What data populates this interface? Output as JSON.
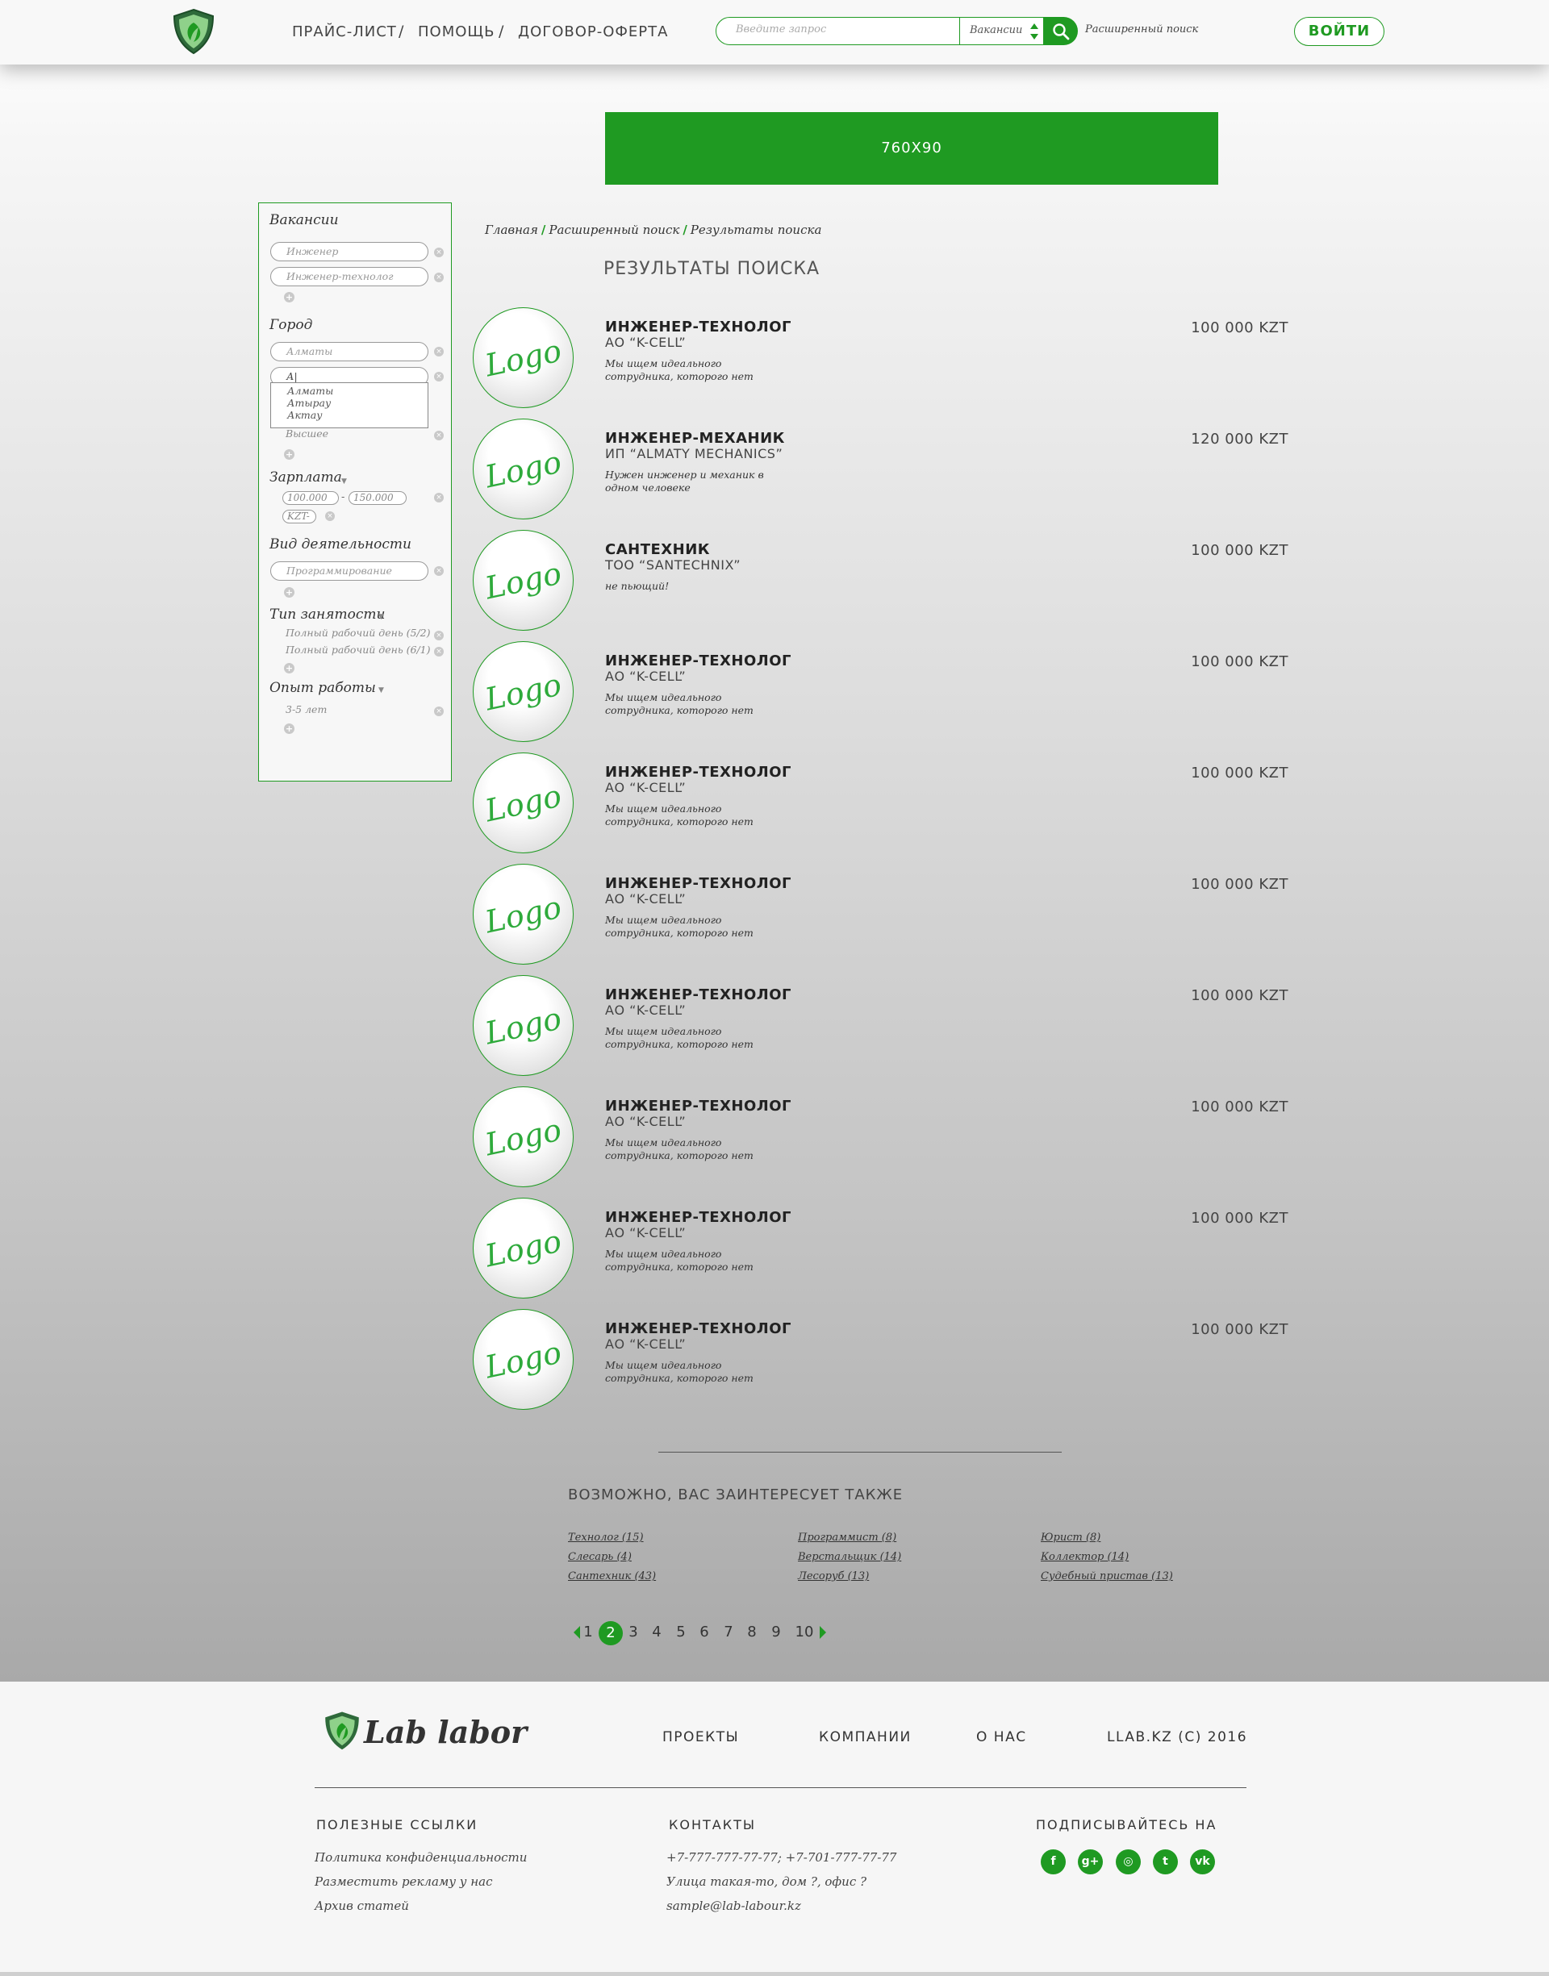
{
  "colors": {
    "accent": "#1f9a22",
    "logo_text": "#2eaa3b"
  },
  "header": {
    "nav": [
      "ПРАЙС-ЛИСТ",
      "ПОМОЩЬ",
      "ДОГОВОР-ОФЕРТА"
    ],
    "nav_separator": "/",
    "search": {
      "placeholder": "Введите запрос",
      "category": "Вакансии",
      "advanced_label": "Расширенный поиск"
    },
    "login_label": "ВОЙТИ"
  },
  "banner": {
    "label": "760X90"
  },
  "sidebar": {
    "vacancies": {
      "heading": "Вакансии",
      "values": [
        "Инженер",
        "Инженер-технолог"
      ]
    },
    "city": {
      "heading": "Город",
      "values": [
        "Алматы",
        "А|"
      ],
      "dropdown_options": [
        "Алматы",
        "Атырау",
        "Актау"
      ],
      "education_value": "Высшее"
    },
    "salary": {
      "heading": "Зарплата",
      "from": "100.000",
      "dash": "-",
      "to": "150.000",
      "currency": "KZT-"
    },
    "activity": {
      "heading": "Вид деятельности",
      "values": [
        "Программирование"
      ]
    },
    "employment": {
      "heading": "Тип занятости",
      "values": [
        "Полный рабочий день (5/2)",
        "Полный рабочий день (6/1)"
      ]
    },
    "experience": {
      "heading": "Опыт работы",
      "values": [
        "3-5 лет"
      ]
    }
  },
  "breadcrumb": [
    "Главная",
    "Расширенный поиск",
    "Результаты поиска"
  ],
  "results_title": "РЕЗУЛЬТАТЫ ПОИСКА",
  "results": [
    {
      "logo": "Logo",
      "title": "ИНЖЕНЕР-ТЕХНОЛОГ",
      "company": "АО “K-CELL”",
      "description": "Мы ищем идеального сотрудника, которого нет",
      "salary": "100 000 KZT"
    },
    {
      "logo": "Logo",
      "title": "ИНЖЕНЕР-МЕХАНИК",
      "company": "ИП “ALMATY MECHANICS”",
      "description": "Нужен инженер и механик в одном человеке",
      "salary": "120 000 KZT"
    },
    {
      "logo": "Logo",
      "title": "САНТЕХНИК",
      "company": "ТОО “SANTECHNIX”",
      "description": "не пьющий!",
      "salary": "100 000 KZT"
    },
    {
      "logo": "Logo",
      "title": "ИНЖЕНЕР-ТЕХНОЛОГ",
      "company": "АО “K-CELL”",
      "description": "Мы ищем идеального сотрудника, которого нет",
      "salary": "100 000 KZT"
    },
    {
      "logo": "Logo",
      "title": "ИНЖЕНЕР-ТЕХНОЛОГ",
      "company": "АО “K-CELL”",
      "description": "Мы ищем идеального сотрудника, которого нет",
      "salary": "100 000 KZT"
    },
    {
      "logo": "Logo",
      "title": "ИНЖЕНЕР-ТЕХНОЛОГ",
      "company": "АО “K-CELL”",
      "description": "Мы ищем идеального сотрудника, которого нет",
      "salary": "100 000 KZT"
    },
    {
      "logo": "Logo",
      "title": "ИНЖЕНЕР-ТЕХНОЛОГ",
      "company": "АО “K-CELL”",
      "description": "Мы ищем идеального сотрудника, которого нет",
      "salary": "100 000 KZT"
    },
    {
      "logo": "Logo",
      "title": "ИНЖЕНЕР-ТЕХНОЛОГ",
      "company": "АО “K-CELL”",
      "description": "Мы ищем идеального сотрудника, которого нет",
      "salary": "100 000 KZT"
    },
    {
      "logo": "Logo",
      "title": "ИНЖЕНЕР-ТЕХНОЛОГ",
      "company": "АО “K-CELL”",
      "description": "Мы ищем идеального сотрудника, которого нет",
      "salary": "100 000 KZT"
    },
    {
      "logo": "Logo",
      "title": "ИНЖЕНЕР-ТЕХНОЛОГ",
      "company": "АО “K-CELL”",
      "description": "Мы ищем идеального сотрудника, которого нет",
      "salary": "100 000 KZT"
    }
  ],
  "related": {
    "title": "ВОЗМОЖНО, ВАС ЗАИНТЕРЕСУЕТ ТАКЖЕ",
    "columns": [
      [
        "Технолог (15)",
        "Слесарь (4)",
        "Сантехник (43)"
      ],
      [
        "Программист (8)",
        "Верстальщик (14)",
        "Лесоруб (13)"
      ],
      [
        "Юрист (8)",
        "Коллектор (14)",
        "Судебный пристав (13)"
      ]
    ]
  },
  "pagination": {
    "pages": [
      "1",
      "2",
      "3",
      "4",
      "5",
      "6",
      "7",
      "8",
      "9",
      "10"
    ],
    "current": "2"
  },
  "footer": {
    "brand": "Lab labor",
    "nav": [
      "ПРОЕКТЫ",
      "КОМПАНИИ",
      "О НАС"
    ],
    "copyright": "LLAB.KZ (C) 2016",
    "useful_links": {
      "heading": "ПОЛЕЗНЫЕ ССЫЛКИ",
      "items": [
        "Политика конфиденциальности",
        "Разместить рекламу у нас",
        "Архив статей"
      ]
    },
    "contacts": {
      "heading": "КОНТАКТЫ",
      "items": [
        "+7-777-777-77-77; +7-701-777-77-77",
        "Улица такая-то, дом ?, офис ?",
        "sample@lab-labour.kz"
      ]
    },
    "subscribe": {
      "heading": "ПОДПИСЫВАЙТЕСЬ НА",
      "icons": [
        "facebook-icon",
        "google-plus-icon",
        "instagram-icon",
        "twitter-icon",
        "vk-icon"
      ],
      "glyphs": [
        "f",
        "g+",
        "◎",
        "t",
        "vk"
      ]
    }
  }
}
